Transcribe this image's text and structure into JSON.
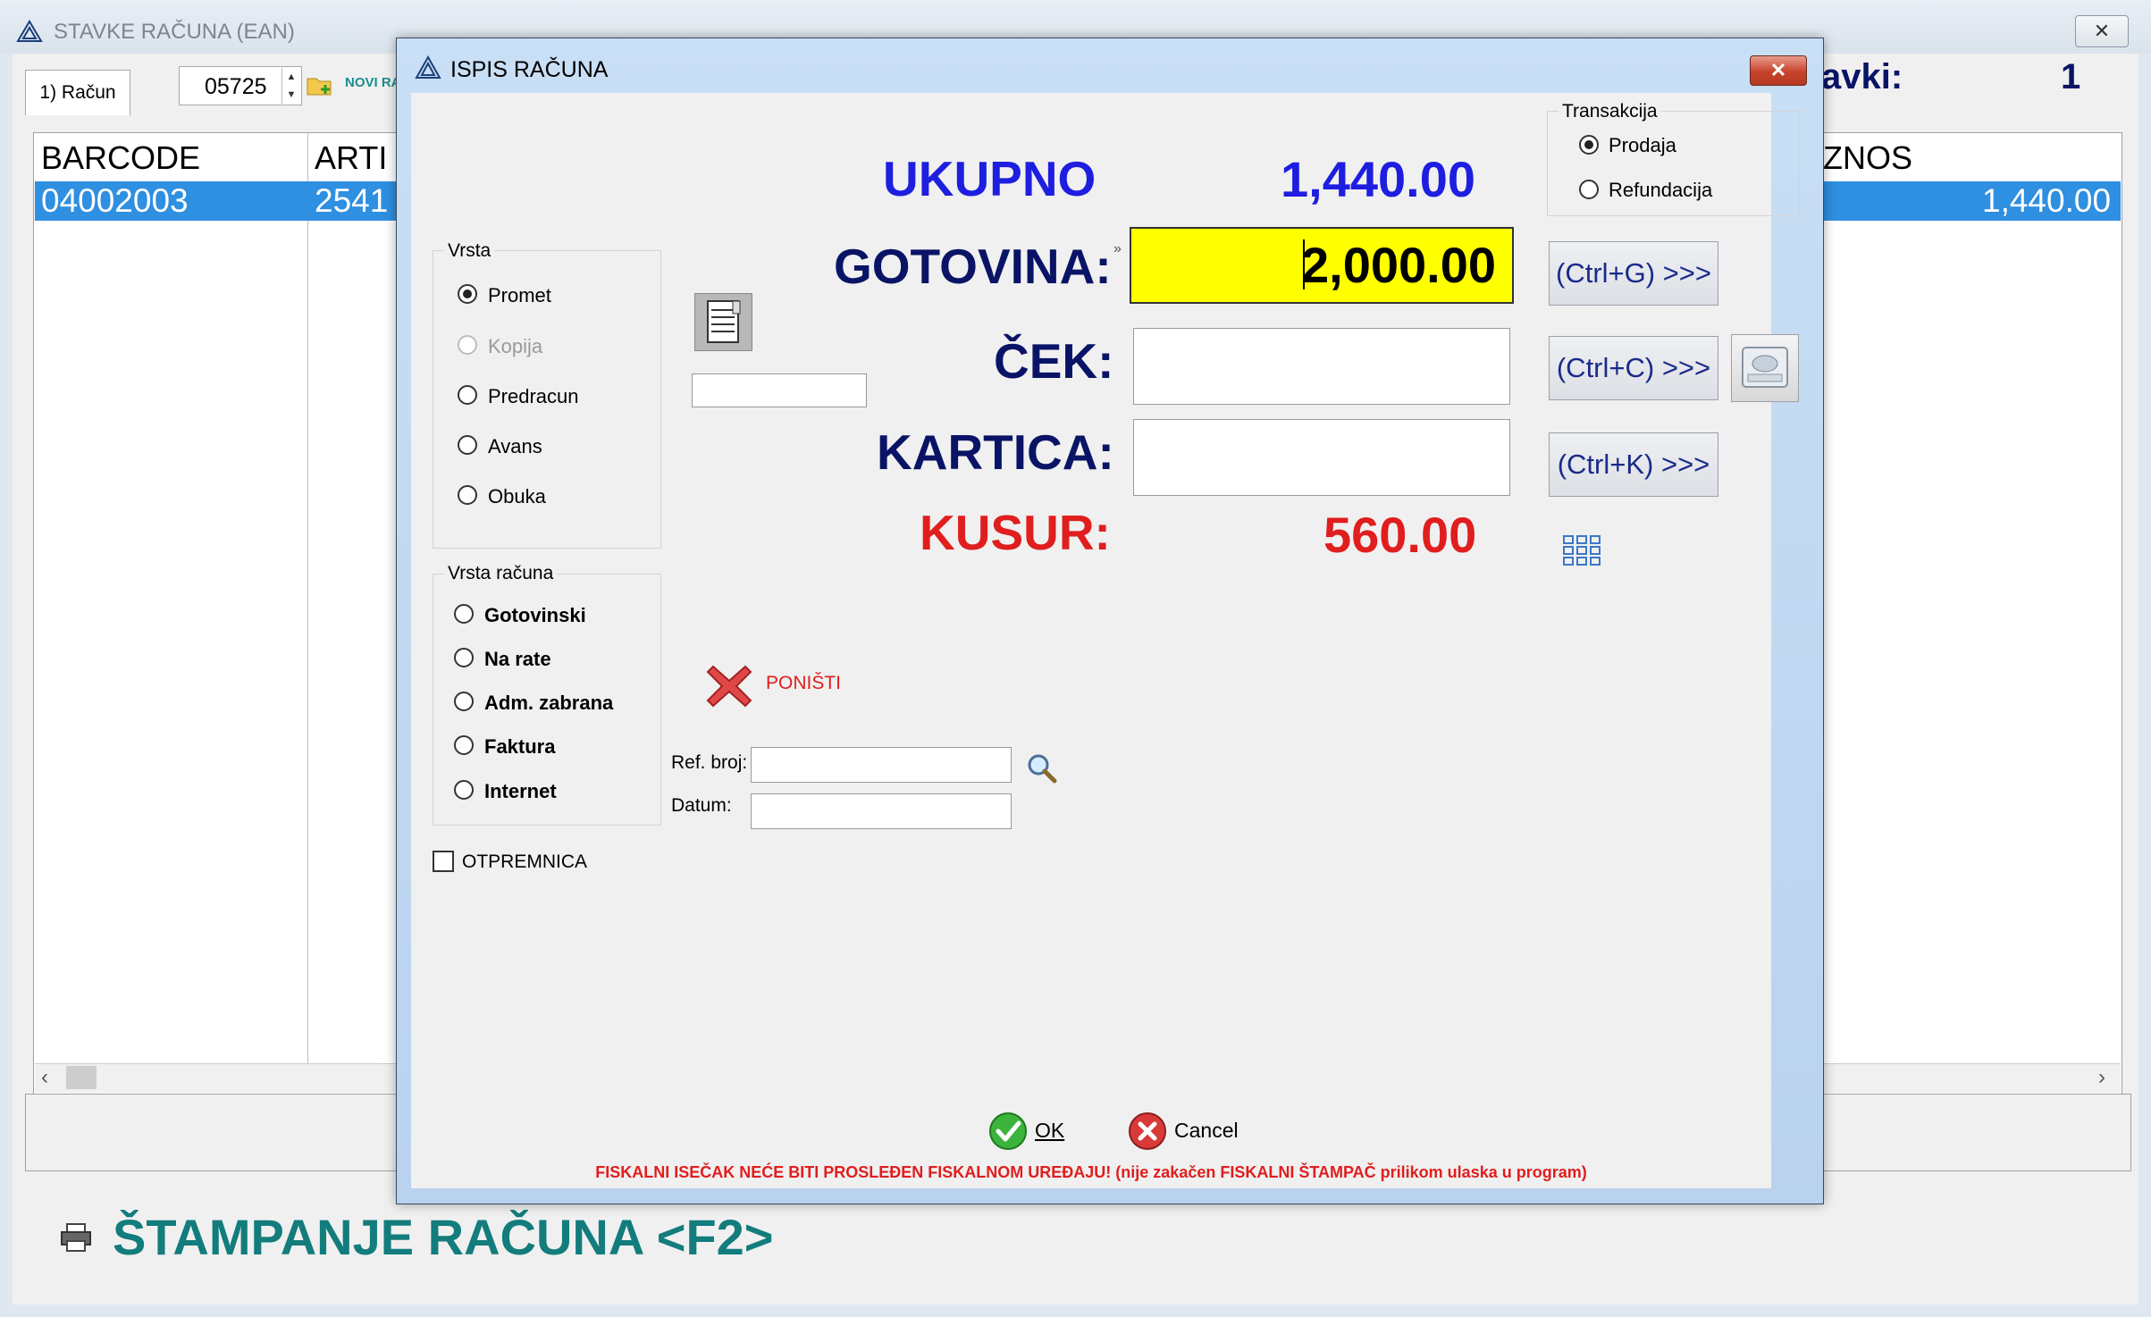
{
  "background_window": {
    "title": "STAVKE RAČUNA (EAN)",
    "close_glyph": "✕",
    "tab_label": "1) Račun",
    "invoice_number": "05725",
    "new_button_label": "NOVI RA",
    "stavki_label": "avki:",
    "stavki_count": "1",
    "grid": {
      "headers": [
        "BARCODE",
        "ARTI",
        "ZNOS"
      ],
      "row": {
        "barcode": "04002003",
        "article": "2541",
        "iznos": "1,440.00"
      }
    },
    "print_label": "ŠTAMPANJE RAČUNA <F2>"
  },
  "dialog": {
    "title": "ISPIS RAČUNA",
    "close_glyph": "✕",
    "ukupno_label": "UKUPNO",
    "ukupno_value": "1,440.00",
    "gotovina_label": "GOTOVINA:",
    "gotovina_value": "2,000.00",
    "cek_label": "ČEK:",
    "kartica_label": "KARTICA:",
    "kusur_label": "KUSUR:",
    "kusur_value": "560.00",
    "ctrl_g": "(Ctrl+G) >>>",
    "ctrl_c": "(Ctrl+C) >>>",
    "ctrl_k": "(Ctrl+K) >>>",
    "transakcija": {
      "title": "Transakcija",
      "options": [
        "Prodaja",
        "Refundacija"
      ],
      "selected": "Prodaja"
    },
    "vrsta": {
      "title": "Vrsta",
      "options": [
        "Promet",
        "Kopija",
        "Predracun",
        "Avans",
        "Obuka"
      ],
      "selected": "Promet",
      "disabled": "Kopija"
    },
    "vrsta_racuna": {
      "title": "Vrsta računa",
      "options": [
        "Gotovinski",
        "Na rate",
        "Adm. zabrana",
        "Faktura",
        "Internet"
      ]
    },
    "ponisti_label": "PONIŠTI",
    "ref_label": "Ref. broj:",
    "datum_label": "Datum:",
    "otpremnica_label": "OTPREMNICA",
    "ok_label": "OK",
    "cancel_label": "Cancel",
    "fiscal_message": "FISKALNI ISEČAK NEĆE BITI PROSLEĐEN FISKALNOM UREĐAJU! (nije zakačen FISKALNI ŠTAMPAČ prilikom ulaska u program)"
  },
  "colors": {
    "total_blue": "#1e1ee0",
    "label_navy": "#0a1466",
    "change_red": "#e01e1e",
    "cash_input_bg": "#ffff00",
    "selected_row": "#2f8fe0",
    "teal": "#137c7c"
  },
  "icons": [
    "app-logo-icon",
    "printer-icon",
    "cash-drawer-icon",
    "grid-icon",
    "cancel-x-icon",
    "search-icon",
    "ok-check-icon",
    "cancel-circle-icon",
    "folder-add-icon"
  ]
}
